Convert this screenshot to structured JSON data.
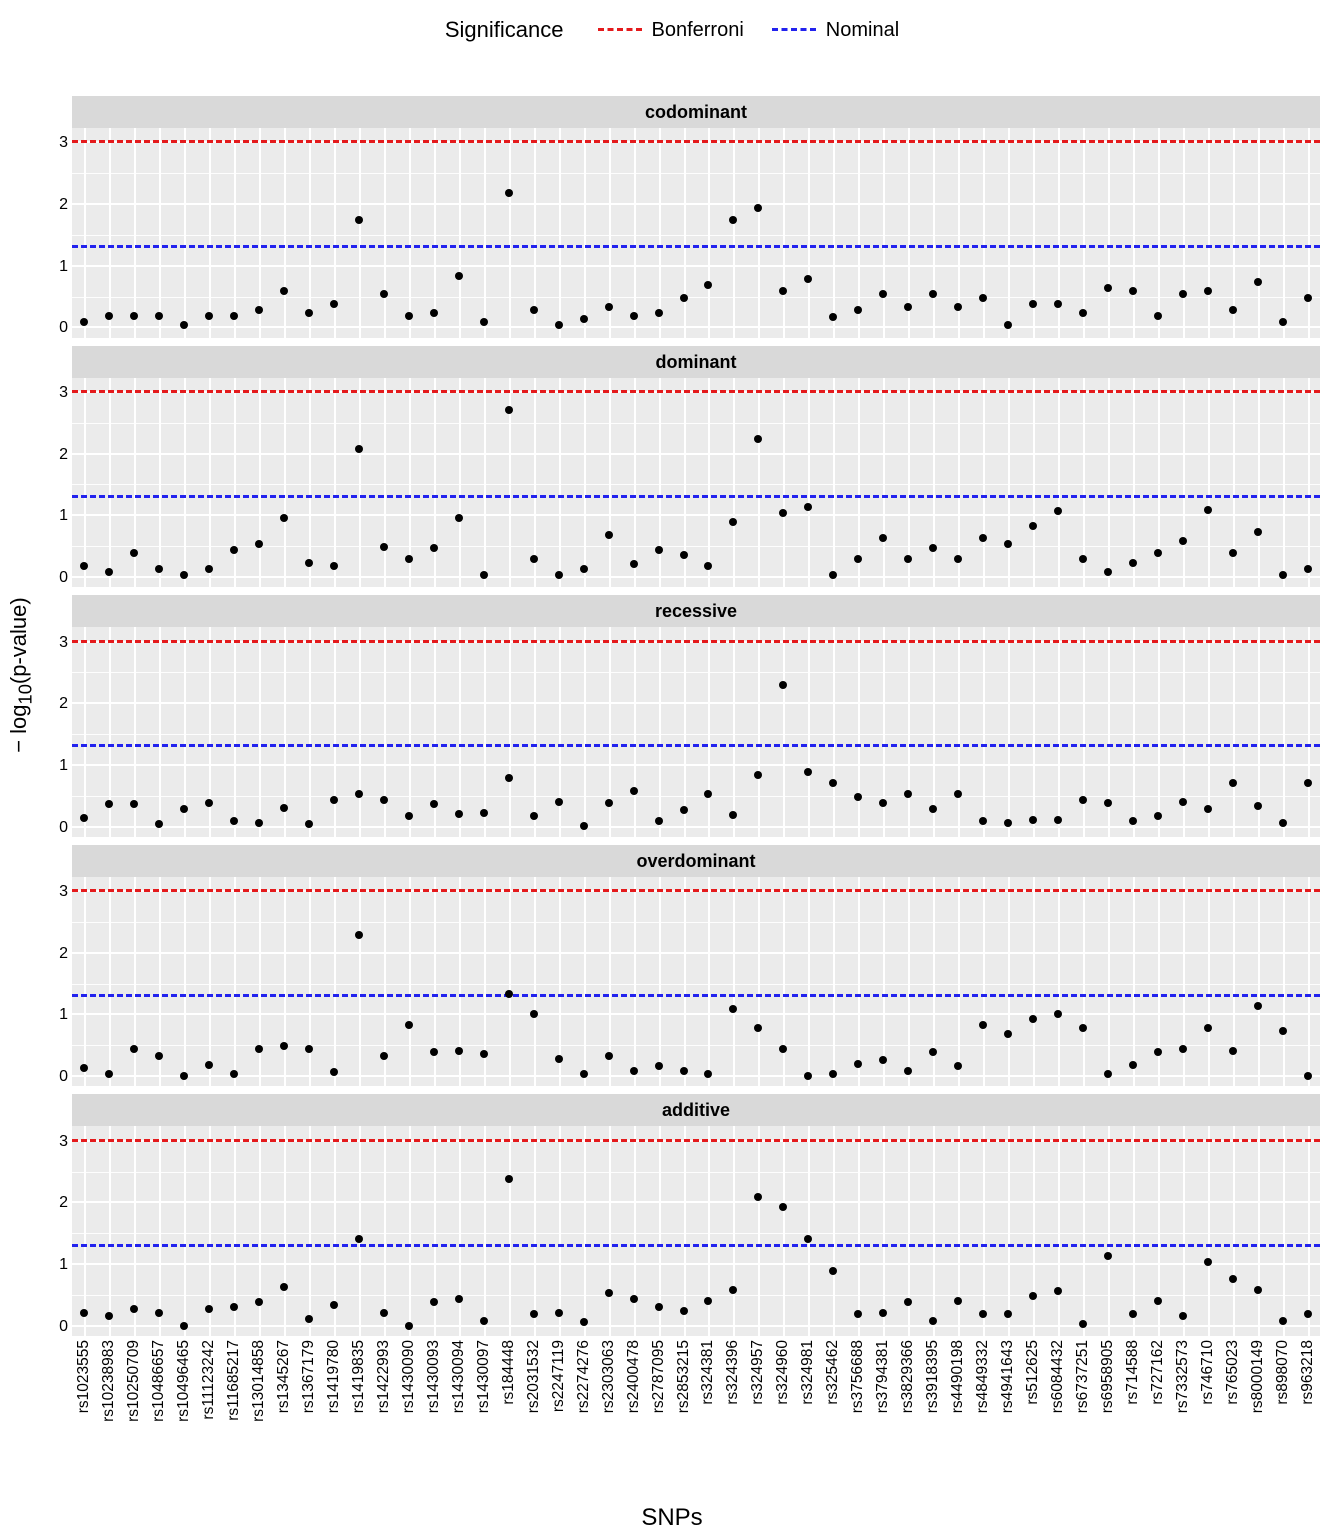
{
  "legend": {
    "title": "Significance",
    "items": [
      {
        "name": "Bonferroni",
        "color": "#e41a1c"
      },
      {
        "name": "Nominal",
        "color": "#2222ee"
      }
    ]
  },
  "axis": {
    "x_title": "SNPs",
    "y_title": "− log₁₀(p-value)",
    "y_breaks": [
      0,
      1,
      2,
      3
    ],
    "y_minor": [
      0.5,
      1.5,
      2.5
    ],
    "y_range": [
      -0.15,
      3.25
    ]
  },
  "siglines": {
    "Bonferroni": 3.0,
    "Nominal": 1.3
  },
  "snps": [
    "rs1023555",
    "rs10238983",
    "rs10250709",
    "rs10486657",
    "rs10496465",
    "rs11123242",
    "rs11685217",
    "rs13014858",
    "rs1345267",
    "rs1367179",
    "rs1419780",
    "rs1419835",
    "rs1422993",
    "rs1430090",
    "rs1430093",
    "rs1430094",
    "rs1430097",
    "rs184448",
    "rs2031532",
    "rs2247119",
    "rs2274276",
    "rs2303063",
    "rs2400478",
    "rs2787095",
    "rs2853215",
    "rs324381",
    "rs324396",
    "rs324957",
    "rs324960",
    "rs324981",
    "rs325462",
    "rs3756688",
    "rs3794381",
    "rs3829366",
    "rs3918395",
    "rs4490198",
    "rs4849332",
    "rs4941643",
    "rs512625",
    "rs6084432",
    "rs6737251",
    "rs6958905",
    "rs714588",
    "rs727162",
    "rs7332573",
    "rs746710",
    "rs765023",
    "rs8000149",
    "rs898070",
    "rs963218"
  ],
  "panels": [
    "codominant",
    "dominant",
    "recessive",
    "overdominant",
    "additive"
  ],
  "chart_data": [
    {
      "type": "scatter",
      "name": "codominant",
      "title": "codominant",
      "xlabel": "SNPs",
      "ylabel": "-log10(p-value)",
      "ylim": [
        -0.15,
        3.25
      ],
      "x": "snps",
      "values": [
        0.1,
        0.2,
        0.2,
        0.2,
        0.05,
        0.2,
        0.2,
        0.3,
        0.6,
        0.25,
        0.4,
        1.75,
        0.55,
        0.2,
        0.25,
        0.85,
        0.1,
        2.2,
        0.3,
        0.05,
        0.15,
        0.35,
        0.2,
        0.25,
        0.5,
        0.7,
        1.75,
        1.95,
        0.6,
        0.8,
        0.18,
        0.3,
        0.55,
        0.35,
        0.55,
        0.35,
        0.5,
        0.05,
        0.4,
        0.4,
        0.25,
        0.65,
        0.6,
        0.2,
        0.55,
        0.6,
        0.3,
        0.75,
        0.1,
        0.5
      ]
    },
    {
      "type": "scatter",
      "name": "dominant",
      "title": "dominant",
      "xlabel": "SNPs",
      "ylabel": "-log10(p-value)",
      "ylim": [
        -0.15,
        3.25
      ],
      "x": "snps",
      "values": [
        0.2,
        0.1,
        0.4,
        0.15,
        0.05,
        0.15,
        0.45,
        0.55,
        0.98,
        0.25,
        0.2,
        2.1,
        0.5,
        0.3,
        0.48,
        0.98,
        0.05,
        2.72,
        0.3,
        0.05,
        0.15,
        0.7,
        0.22,
        0.45,
        0.38,
        0.2,
        0.9,
        2.25,
        1.05,
        1.15,
        0.05,
        0.3,
        0.65,
        0.3,
        0.48,
        0.3,
        0.65,
        0.55,
        0.85,
        1.08,
        0.3,
        0.1,
        0.25,
        0.4,
        0.6,
        1.1,
        0.4,
        0.75,
        0.05,
        0.15
      ]
    },
    {
      "type": "scatter",
      "name": "recessive",
      "title": "recessive",
      "xlabel": "SNPs",
      "ylabel": "-log10(p-value)",
      "ylim": [
        -0.15,
        3.25
      ],
      "x": "snps",
      "values": [
        0.15,
        0.38,
        0.38,
        0.05,
        0.3,
        0.4,
        0.1,
        0.08,
        0.32,
        0.05,
        0.45,
        0.55,
        0.45,
        0.18,
        0.38,
        0.22,
        0.23,
        0.8,
        0.18,
        0.42,
        0.02,
        0.4,
        0.6,
        0.1,
        0.28,
        0.55,
        0.2,
        0.85,
        2.32,
        0.9,
        0.72,
        0.5,
        0.4,
        0.55,
        0.3,
        0.55,
        0.1,
        0.07,
        0.12,
        0.12,
        0.45,
        0.4,
        0.1,
        0.18,
        0.42,
        0.3,
        0.72,
        0.35,
        0.08,
        0.72
      ]
    },
    {
      "type": "scatter",
      "name": "overdominant",
      "title": "overdominant",
      "xlabel": "SNPs",
      "ylabel": "-log10(p-value)",
      "ylim": [
        -0.15,
        3.25
      ],
      "x": "snps",
      "values": [
        0.15,
        0.05,
        0.45,
        0.35,
        0.02,
        0.2,
        0.05,
        0.45,
        0.5,
        0.45,
        0.08,
        2.3,
        0.35,
        0.85,
        0.4,
        0.42,
        0.37,
        1.35,
        1.02,
        0.3,
        0.05,
        0.35,
        0.1,
        0.18,
        0.1,
        0.05,
        1.1,
        0.8,
        0.45,
        0.02,
        0.05,
        0.22,
        0.28,
        0.1,
        0.4,
        0.18,
        0.85,
        0.7,
        0.95,
        1.03,
        0.8,
        0.05,
        0.2,
        0.4,
        0.45,
        0.8,
        0.42,
        1.15,
        0.75,
        0.02
      ]
    },
    {
      "type": "scatter",
      "name": "additive",
      "title": "additive",
      "xlabel": "SNPs",
      "ylabel": "-log10(p-value)",
      "ylim": [
        -0.15,
        3.25
      ],
      "x": "snps",
      "values": [
        0.22,
        0.18,
        0.28,
        0.22,
        0.02,
        0.28,
        0.32,
        0.4,
        0.65,
        0.13,
        0.35,
        1.42,
        0.22,
        0.02,
        0.4,
        0.45,
        0.1,
        2.4,
        0.2,
        0.22,
        0.08,
        0.55,
        0.45,
        0.32,
        0.25,
        0.42,
        0.6,
        2.1,
        1.95,
        1.42,
        0.9,
        0.2,
        0.22,
        0.4,
        0.1,
        0.42,
        0.2,
        0.2,
        0.5,
        0.58,
        0.05,
        1.15,
        0.2,
        0.42,
        0.18,
        1.05,
        0.78,
        0.6,
        0.1,
        0.2
      ]
    }
  ]
}
